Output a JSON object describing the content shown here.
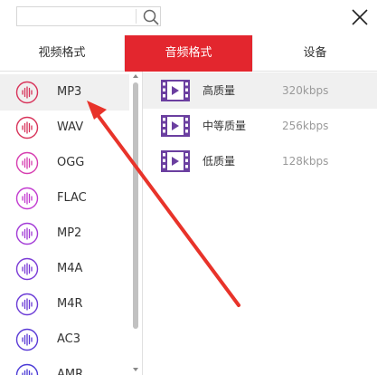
{
  "search": {
    "placeholder": "",
    "value": ""
  },
  "tabs": [
    {
      "label": "视频格式",
      "active": false
    },
    {
      "label": "音频格式",
      "active": true
    },
    {
      "label": "设备",
      "active": false
    }
  ],
  "formats": [
    {
      "label": "MP3",
      "selected": true,
      "color": "#d8335a"
    },
    {
      "label": "WAV",
      "selected": false,
      "color": "#d8335a"
    },
    {
      "label": "OGG",
      "selected": false,
      "color": "#d63cb0"
    },
    {
      "label": "FLAC",
      "selected": false,
      "color": "#c23ad0"
    },
    {
      "label": "MP2",
      "selected": false,
      "color": "#a23ad6"
    },
    {
      "label": "M4A",
      "selected": false,
      "color": "#7a3ad6"
    },
    {
      "label": "M4R",
      "selected": false,
      "color": "#6a3ad6"
    },
    {
      "label": "AC3",
      "selected": false,
      "color": "#5a3ad6"
    },
    {
      "label": "AMR",
      "selected": false,
      "color": "#4a3ad6"
    }
  ],
  "qualities": [
    {
      "name": "高质量",
      "rate": "320kbps",
      "selected": true
    },
    {
      "name": "中等质量",
      "rate": "256kbps",
      "selected": false
    },
    {
      "name": "低质量",
      "rate": "128kbps",
      "selected": false
    }
  ],
  "colors": {
    "accent": "#e3262e",
    "video_icon": "#6b3fa0",
    "arrow": "#e8332a"
  }
}
